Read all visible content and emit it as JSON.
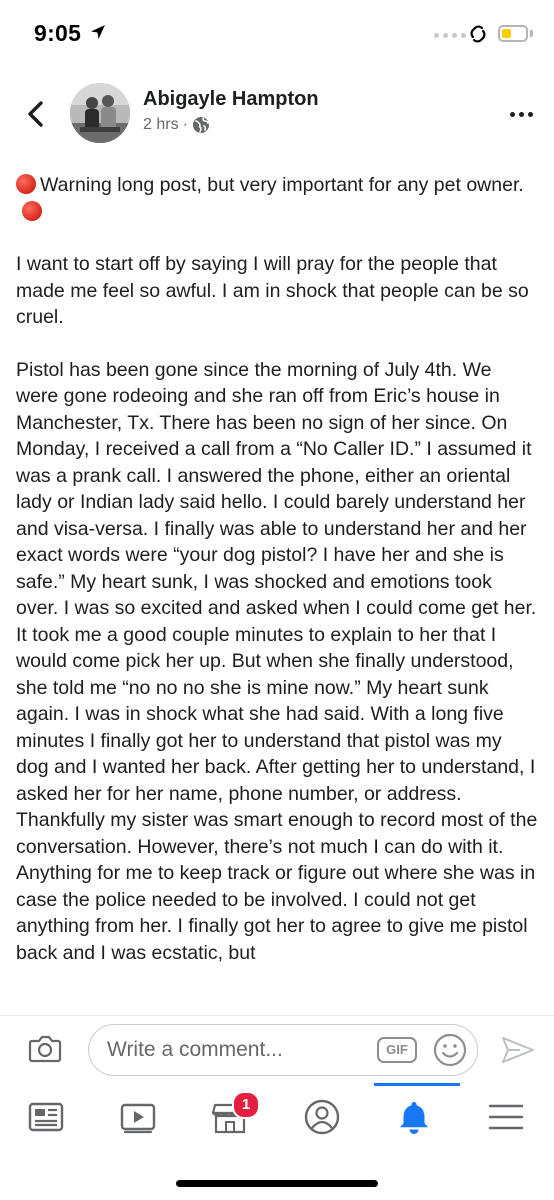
{
  "status_bar": {
    "time": "9:05",
    "battery_level": 0.4,
    "battery_color": "#ffcc00"
  },
  "post": {
    "author": "Abigayle Hampton",
    "time_ago": "2 hrs",
    "separator": "·",
    "privacy_icon": "globe-icon",
    "paragraphs": [
      "Warning long post, but very important for any pet owner.",
      "I want to start off by saying I will pray for the people that made me feel so awful. I am in shock that people can be so cruel.",
      "Pistol has been gone since the morning of July 4th. We were gone rodeoing and she ran off from Eric’s house in Manchester, Tx. There has been no sign of her since. On Monday, I received a call from a “No Caller ID.” I assumed it was a prank call. I answered the phone, either an oriental lady or Indian lady said hello. I could barely understand her and visa-versa. I finally was able to understand her and her exact words were “your dog pistol? I have her and she is safe.” My heart sunk, I was shocked and emotions took over. I was so excited and asked when I could come get her. It took me a good couple minutes to explain to her that I would come pick her up. But when she finally understood, she told me “no no no she is mine now.” My heart sunk again. I was in shock what she had said. With a long five minutes I finally got her to understand that pistol was my dog and I wanted her back. After getting her to understand, I asked her for her name, phone number, or address. Thankfully my sister was smart enough to record most of the conversation. However, there’s not much I can do with it. Anything for me to keep track or figure out where she was in case the police needed to be involved. I could not get anything from her. I finally got her to agree to give me pistol back and I was ecstatic, but"
    ]
  },
  "comment_bar": {
    "placeholder": "Write a comment...",
    "gif_label": "GIF"
  },
  "nav": {
    "items": [
      {
        "name": "news-feed",
        "icon": "news-feed-icon"
      },
      {
        "name": "watch",
        "icon": "video-play-icon"
      },
      {
        "name": "marketplace",
        "icon": "marketplace-store-icon",
        "badge": "1"
      },
      {
        "name": "profile",
        "icon": "profile-icon"
      },
      {
        "name": "notifications",
        "icon": "bell-icon",
        "active": true
      },
      {
        "name": "menu",
        "icon": "hamburger-menu-icon"
      }
    ],
    "active_color": "#1877f2",
    "badge_color": "#e41e3f"
  }
}
